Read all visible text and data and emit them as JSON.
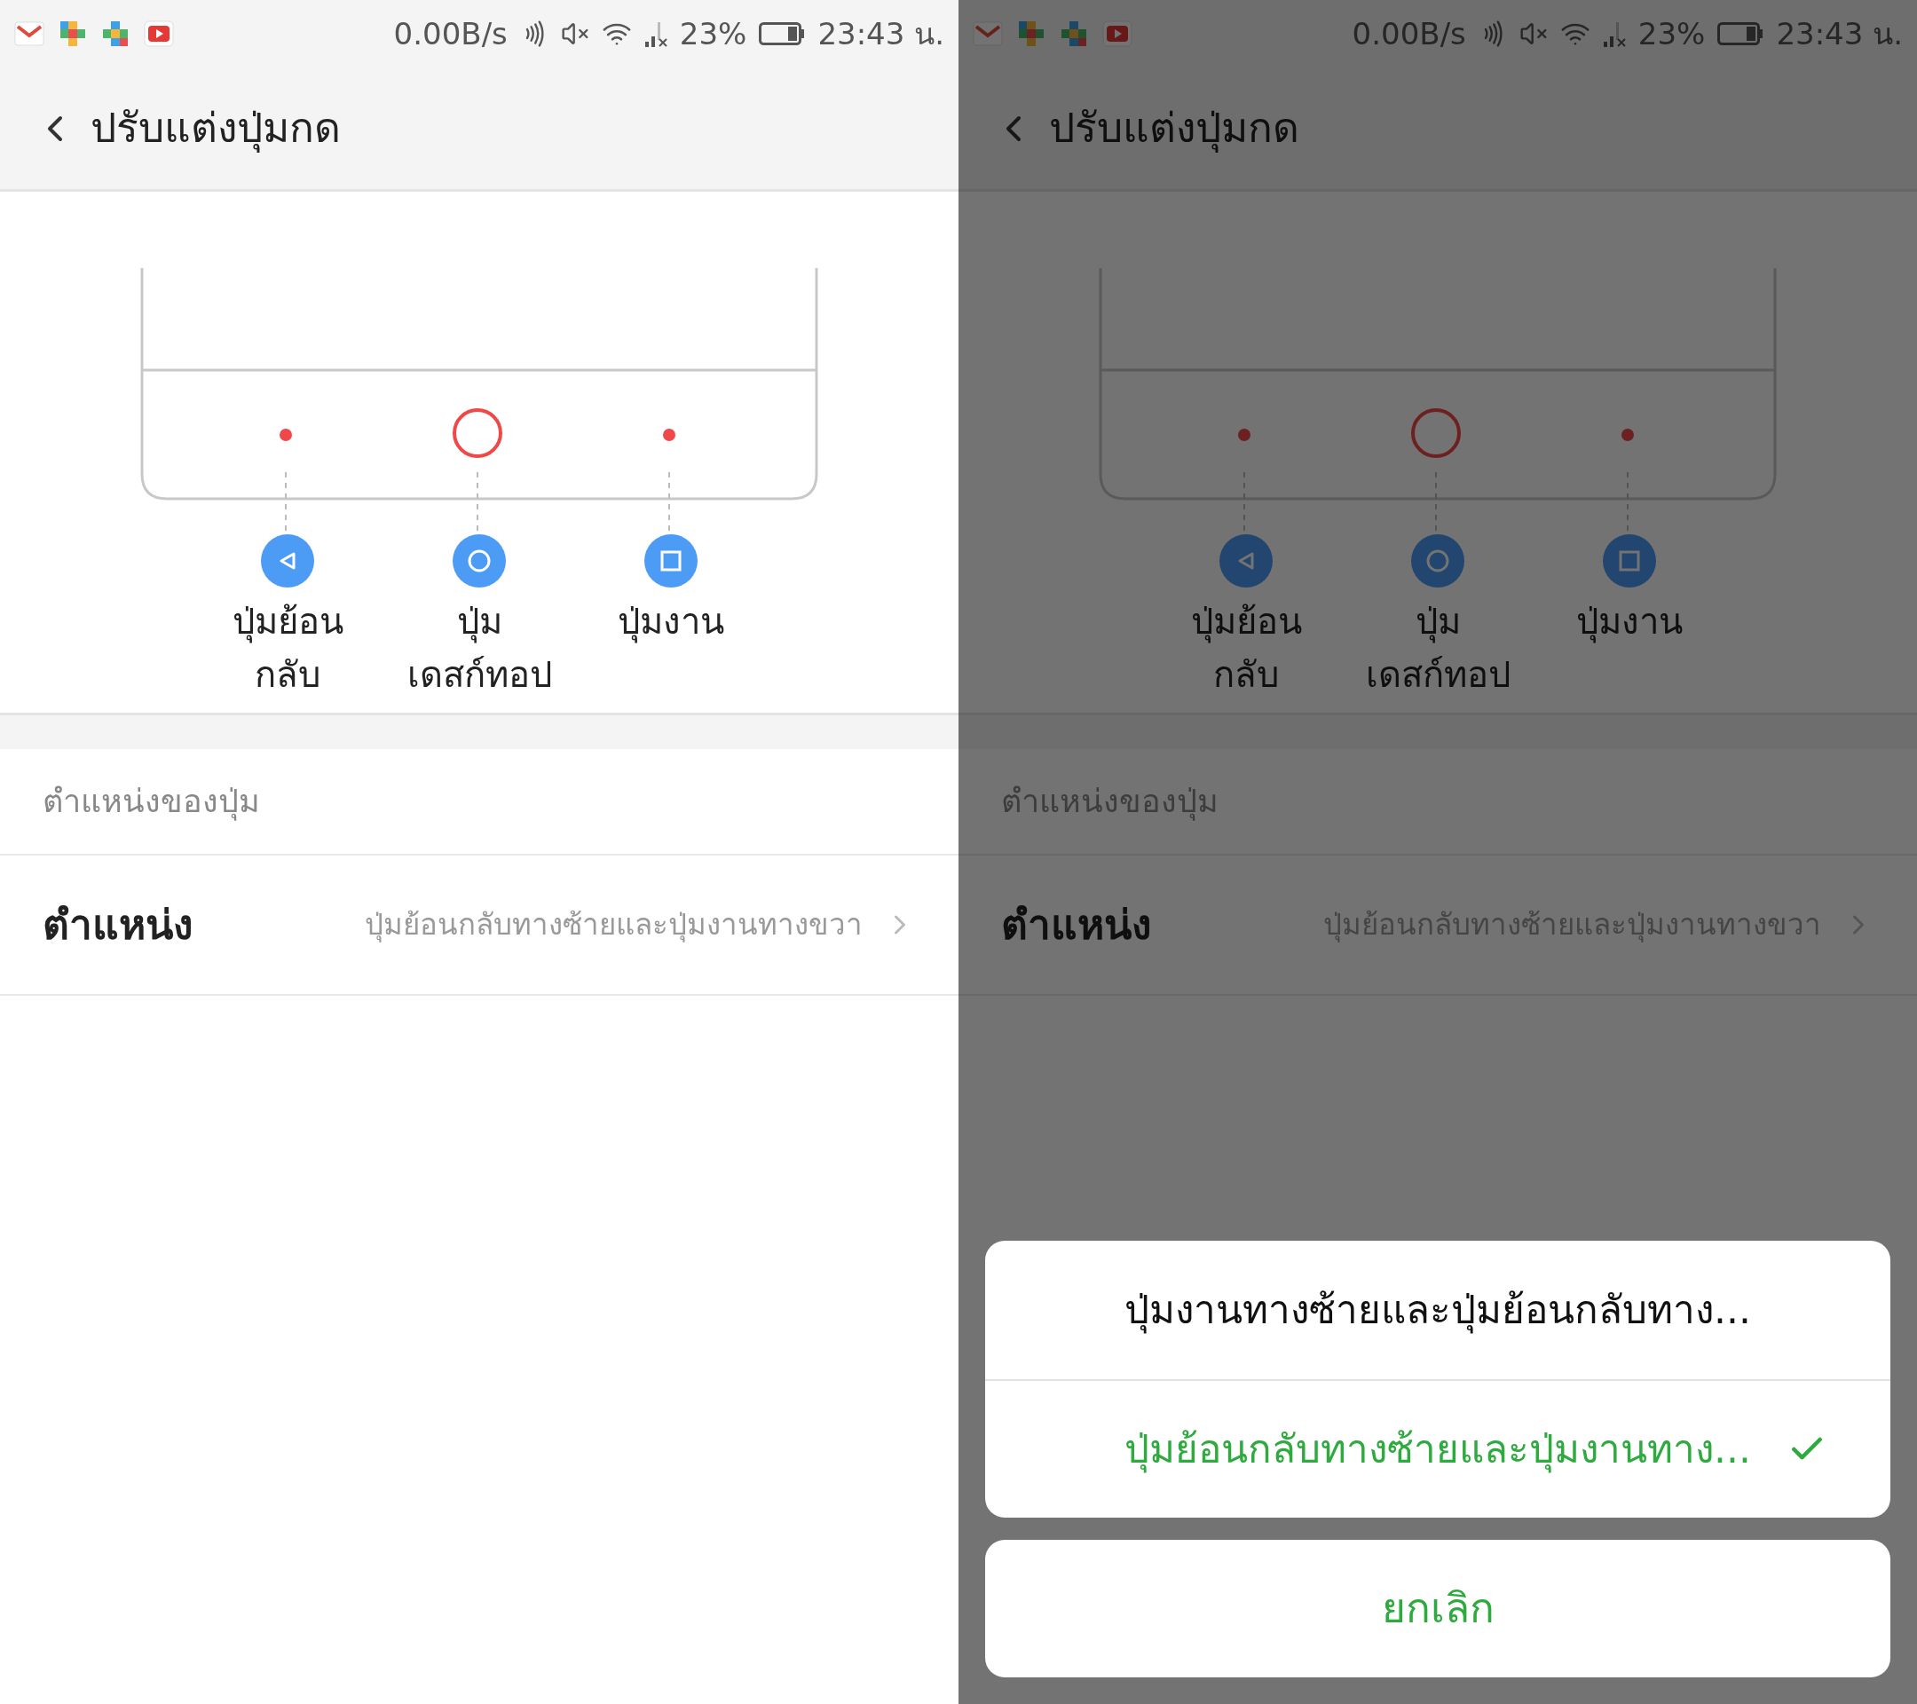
{
  "screens": [
    {
      "status_bar": {
        "speed": "0.00B/s",
        "battery": "23%",
        "time": "23:43 น."
      },
      "header": {
        "title": "ปรับแต่งปุ่มกด"
      },
      "nav_keys": [
        {
          "kind": "back",
          "label": "ปุ่มย้อน\nกลับ"
        },
        {
          "kind": "home",
          "label": "ปุ่ม\nเดสก์ทอป"
        },
        {
          "kind": "recent",
          "label": "ปุ่มงาน"
        }
      ],
      "section_label": "ตำแหน่งของปุ่ม",
      "row": {
        "label": "ตำแหน่ง",
        "value": "ปุ่มย้อนกลับทางซ้ายและปุ่มงานทางขวา"
      }
    },
    {
      "status_bar": {
        "speed": "0.00B/s",
        "battery": "23%",
        "time": "23:43 น."
      },
      "header": {
        "title": "ปรับแต่งปุ่มกด"
      },
      "nav_keys": [
        {
          "kind": "back",
          "label": "ปุ่มย้อน\nกลับ"
        },
        {
          "kind": "home",
          "label": "ปุ่ม\nเดสก์ทอป"
        },
        {
          "kind": "recent",
          "label": "ปุ่มงาน"
        }
      ],
      "section_label": "ตำแหน่งของปุ่ม",
      "row": {
        "label": "ตำแหน่ง",
        "value": "ปุ่มย้อนกลับทางซ้ายและปุ่มงานทางขวา"
      },
      "action_sheet": {
        "options": [
          {
            "label": "ปุ่มงานทางซ้ายและปุ่มย้อนกลับทาง...",
            "selected": false
          },
          {
            "label": "ปุ่มย้อนกลับทางซ้ายและปุ่มงานทาง...",
            "selected": true
          }
        ],
        "cancel": "ยกเลิก"
      }
    }
  ]
}
